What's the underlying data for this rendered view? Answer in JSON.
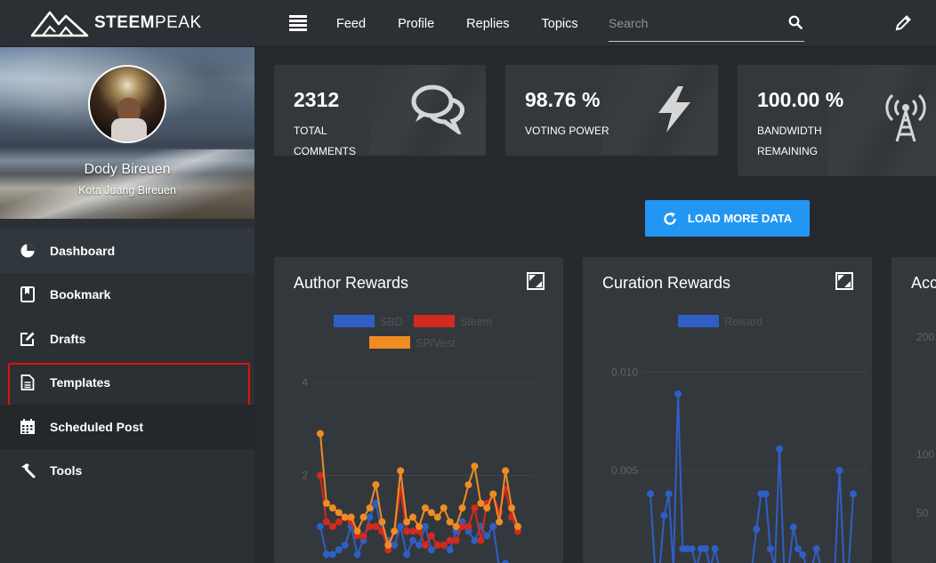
{
  "header": {
    "logo_text_bold": "STEEM",
    "logo_text_rest": "PEAK",
    "nav": [
      "Feed",
      "Profile",
      "Replies",
      "Topics"
    ],
    "search_placeholder": "Search"
  },
  "profile": {
    "name": "Dody Bireuen",
    "location": "Kota Juang Bireuen"
  },
  "sidebar": {
    "items": [
      {
        "label": "Dashboard",
        "icon": "pie-chart-icon"
      },
      {
        "label": "Bookmark",
        "icon": "bookmark-icon"
      },
      {
        "label": "Drafts",
        "icon": "edit-icon"
      },
      {
        "label": "Templates",
        "icon": "file-icon"
      },
      {
        "label": "Scheduled Post",
        "icon": "calendar-icon"
      },
      {
        "label": "Tools",
        "icon": "hammer-icon"
      }
    ]
  },
  "stats": [
    {
      "value": "2312",
      "label": "TOTAL COMMENTS",
      "icon": "comments-icon"
    },
    {
      "value": "98.76 %",
      "label": "VOTING POWER",
      "icon": "lightning-icon"
    },
    {
      "value": "100.00 %",
      "label": "BANDWIDTH REMAINING",
      "icon": "signal-tower-icon"
    }
  ],
  "load_more_label": "LOAD MORE DATA",
  "colors": {
    "sbd": "#2f5fc4",
    "steem": "#d22a1e",
    "spvest": "#f08c22",
    "reward": "#2f5fc4",
    "button": "#2196f3"
  },
  "chart_data": [
    {
      "type": "line",
      "title": "Author Rewards",
      "y_ticks": [
        "4",
        "2"
      ],
      "ylim": [
        0,
        4
      ],
      "legend_position": "top",
      "series": [
        {
          "name": "SBD",
          "values": [
            0.9,
            0.3,
            0.3,
            0.4,
            0.5,
            0.9,
            0.3,
            0.6,
            1.1,
            1.4,
            0.8,
            0.6,
            0.5,
            0.9,
            0.3,
            0.6,
            0.5,
            0.9,
            0.4,
            0.5,
            0.5,
            0.4,
            0.8,
            1.0,
            0.8,
            0.6,
            0.9,
            0.7,
            0.9,
            0.0,
            0.1,
            0.0,
            0.0
          ]
        },
        {
          "name": "Steem",
          "values": [
            2.0,
            1.0,
            0.9,
            1.0,
            1.1,
            1.0,
            0.7,
            0.7,
            0.9,
            0.9,
            0.8,
            0.4,
            0.8,
            1.7,
            0.8,
            0.8,
            0.8,
            0.5,
            0.7,
            0.5,
            0.5,
            0.6,
            0.6,
            0.9,
            0.9,
            1.3,
            0.6,
            1.4,
            1.6,
            1.2,
            1.7,
            1.1,
            0.8
          ]
        },
        {
          "name": "SP/Vest",
          "values": [
            2.9,
            1.4,
            1.3,
            1.2,
            1.1,
            1.1,
            0.8,
            1.1,
            1.3,
            1.8,
            1.0,
            0.5,
            0.8,
            2.1,
            1.0,
            1.1,
            0.9,
            1.3,
            1.2,
            1.1,
            1.3,
            1.0,
            0.9,
            1.3,
            1.8,
            2.2,
            1.4,
            1.3,
            1.6,
            1.0,
            2.1,
            1.3,
            0.9
          ]
        }
      ]
    },
    {
      "type": "line",
      "title": "Curation Rewards",
      "y_ticks": [
        "0.010",
        "0.005"
      ],
      "ylim": [
        0,
        0.011
      ],
      "legend_position": "top",
      "series": [
        {
          "name": "Reward",
          "values": [
            0.0038,
            0.0,
            0.0,
            0.0027,
            0.0038,
            0.0,
            0.0089,
            0.001,
            0.001,
            0.001,
            0.0,
            0.001,
            0.001,
            0.0,
            0.001,
            0.0,
            0.0,
            0.0,
            0.0,
            0.0,
            0.0,
            0.0,
            0.0,
            0.002,
            0.0038,
            0.0038,
            0.001,
            0.0,
            0.0061,
            0.0,
            0.0,
            0.0021,
            0.001,
            0.0007,
            0.0,
            0.0,
            0.001,
            0.0,
            0.0,
            0.0,
            0.0,
            0.005,
            0.0,
            0.0,
            0.0038
          ]
        }
      ]
    },
    {
      "type": "line",
      "title": "Acc",
      "y_ticks": [
        "200",
        "100",
        "50"
      ]
    }
  ]
}
